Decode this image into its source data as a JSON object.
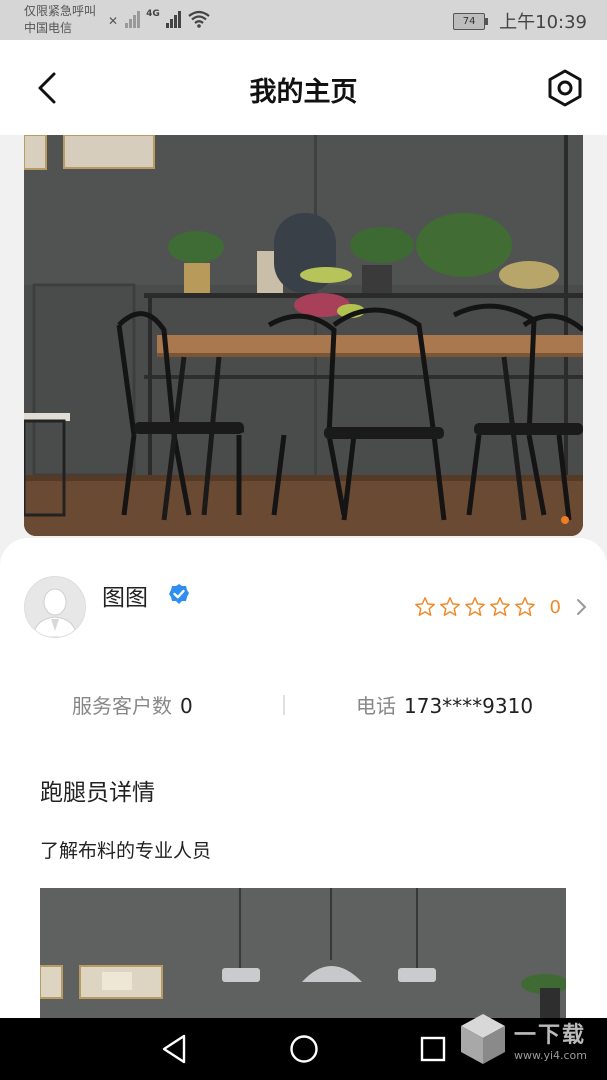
{
  "status_bar": {
    "line1": "仅限紧急呼叫",
    "line2": "中国电信",
    "network": "4G",
    "battery": "74",
    "time": "上午10:39"
  },
  "header": {
    "title": "我的主页",
    "back_icon": "chevron-left-icon",
    "settings_icon": "hex-gear-icon"
  },
  "hero": {
    "carousel_dot_color": "#ef7d21"
  },
  "profile": {
    "name": "图图",
    "verified_icon": "verified-badge-icon",
    "rating": {
      "stars_total": 5,
      "stars_filled": 0,
      "score": "0",
      "star_color": "#ef8a2a"
    }
  },
  "stats": {
    "customers_label": "服务客户数",
    "customers_value": "0",
    "phone_label": "电话",
    "phone_value": "173****9310"
  },
  "details": {
    "section_title": "跑腿员详情",
    "description": "了解布料的专业人员"
  },
  "watermark": {
    "title": "一下载",
    "url": "www.yi4.com"
  }
}
